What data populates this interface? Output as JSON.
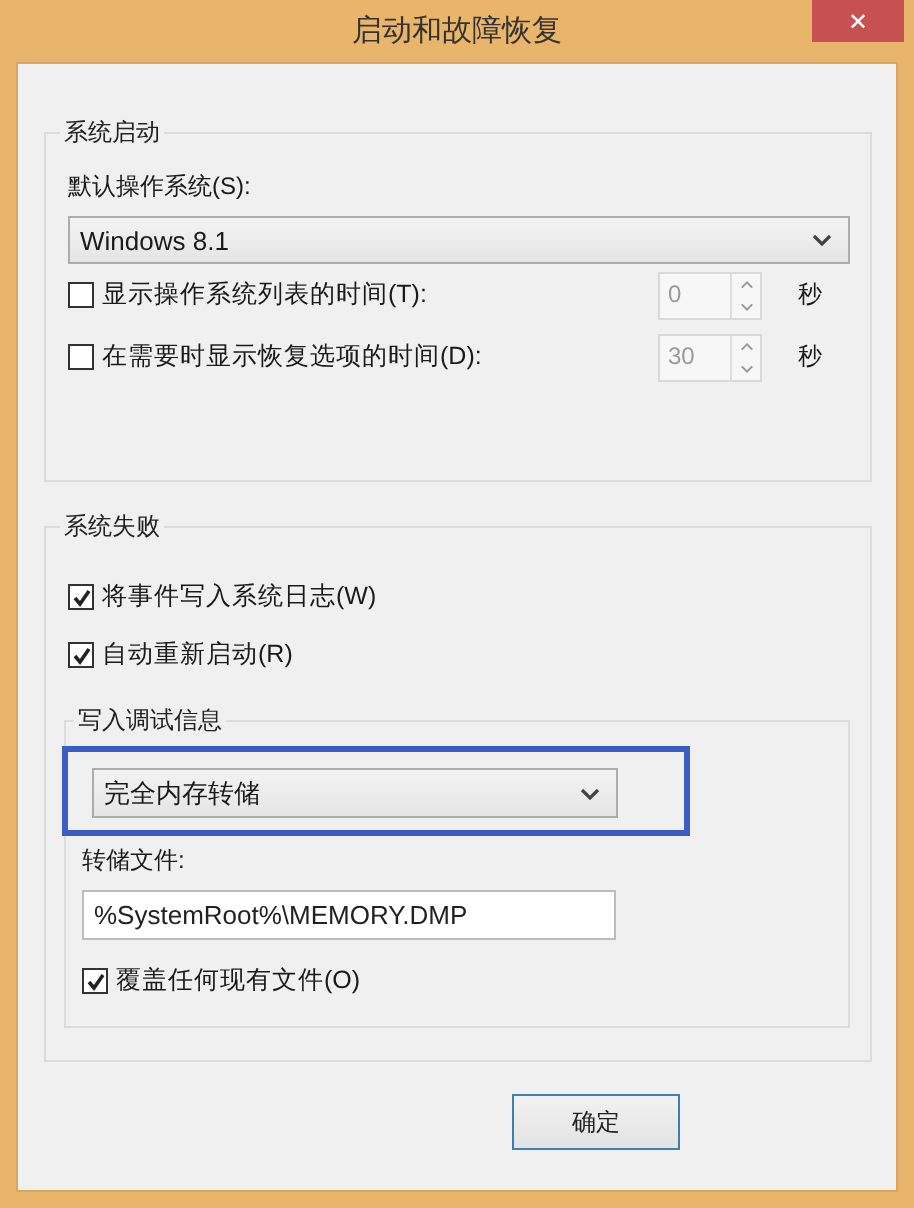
{
  "window": {
    "title": "启动和故障恢复",
    "close": "✕"
  },
  "startup": {
    "title": "系统启动",
    "default_os_label": "默认操作系统(S):",
    "default_os": "Windows 8.1",
    "options": [
      {
        "label": "显示操作系统列表的时间(T):",
        "checked": false,
        "value": "0",
        "unit": "秒",
        "disabled": true
      },
      {
        "label": "在需要时显示恢复选项的时间(D):",
        "checked": false,
        "value": "30",
        "unit": "秒",
        "disabled": true
      }
    ]
  },
  "failure": {
    "title": "系统失败",
    "options": [
      {
        "label": "将事件写入系统日志(W)",
        "checked": true
      },
      {
        "label": "自动重新启动(R)",
        "checked": true
      }
    ],
    "debug": {
      "title": "写入调试信息",
      "dump_type": "完全内存转储",
      "highlighted": true,
      "file_label": "转储文件:",
      "file": "%SystemRoot%\\MEMORY.DMP",
      "overwrite": {
        "label": "覆盖任何现有文件(O)",
        "checked": true
      }
    }
  },
  "buttons": [
    {
      "label": "确定"
    }
  ]
}
